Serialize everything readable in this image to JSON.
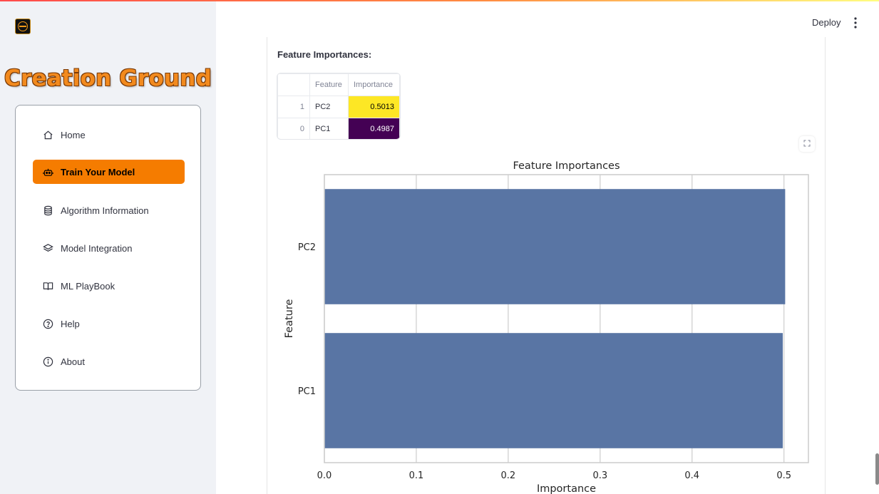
{
  "header": {
    "deploy_label": "Deploy",
    "menu_icon": "kebab-menu-icon"
  },
  "sidebar": {
    "brand_title": "Creation Ground",
    "items": [
      {
        "label": "Home",
        "icon": "home-icon",
        "active": false
      },
      {
        "label": "Train Your Model",
        "icon": "robot-icon",
        "active": true
      },
      {
        "label": "Algorithm Information",
        "icon": "database-icon",
        "active": false
      },
      {
        "label": "Model Integration",
        "icon": "layers-icon",
        "active": false
      },
      {
        "label": "ML PlayBook",
        "icon": "book-icon",
        "active": false
      },
      {
        "label": "Help",
        "icon": "help-circle-icon",
        "active": false
      },
      {
        "label": "About",
        "icon": "info-icon",
        "active": false
      }
    ],
    "active_color": "#f57c00"
  },
  "main": {
    "section_title": "Feature Importances:",
    "table": {
      "columns": [
        "",
        "Feature",
        "Importance"
      ],
      "rows": [
        {
          "index": "1",
          "feature": "PC2",
          "importance": "0.5013",
          "bg": "#fde725",
          "fg": "#000000"
        },
        {
          "index": "0",
          "feature": "PC1",
          "importance": "0.4987",
          "bg": "#440154",
          "fg": "#ffffff"
        }
      ]
    }
  },
  "chart_data": {
    "type": "bar",
    "orientation": "horizontal",
    "title": "Feature Importances",
    "xlabel": "Importance",
    "ylabel": "Feature",
    "categories": [
      "PC2",
      "PC1"
    ],
    "values": [
      0.5013,
      0.4987
    ],
    "xlim": [
      0,
      0.5266
    ],
    "xticks": [
      "0.0",
      "0.1",
      "0.2",
      "0.3",
      "0.4",
      "0.5"
    ],
    "grid": true,
    "bar_color": "#5975a4"
  }
}
